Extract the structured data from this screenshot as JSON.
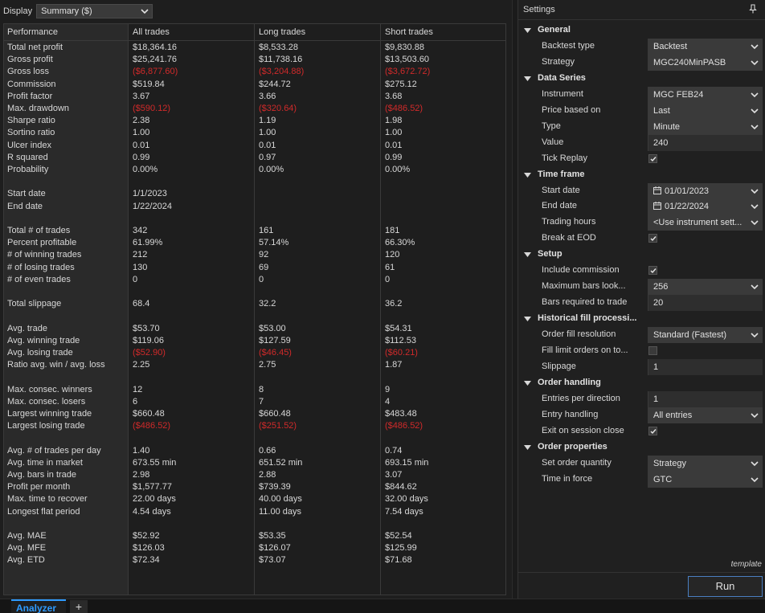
{
  "display": {
    "label": "Display",
    "selected": "Summary ($)"
  },
  "table": {
    "headers": [
      "Performance",
      "All trades",
      "Long trades",
      "Short trades"
    ],
    "rows": [
      {
        "name": "Total net profit",
        "all": "$18,364.16",
        "long": "$8,533.28",
        "short": "$9,830.88",
        "neg": false
      },
      {
        "name": "Gross profit",
        "all": "$25,241.76",
        "long": "$11,738.16",
        "short": "$13,503.60",
        "neg": false
      },
      {
        "name": "Gross loss",
        "all": "($6,877.60)",
        "long": "($3,204.88)",
        "short": "($3,672.72)",
        "neg": true
      },
      {
        "name": "Commission",
        "all": "$519.84",
        "long": "$244.72",
        "short": "$275.12",
        "neg": false
      },
      {
        "name": "Profit factor",
        "all": "3.67",
        "long": "3.66",
        "short": "3.68",
        "neg": false
      },
      {
        "name": "Max. drawdown",
        "all": "($590.12)",
        "long": "($320.64)",
        "short": "($486.52)",
        "neg": true
      },
      {
        "name": "Sharpe ratio",
        "all": "2.38",
        "long": "1.19",
        "short": "1.98",
        "neg": false
      },
      {
        "name": "Sortino ratio",
        "all": "1.00",
        "long": "1.00",
        "short": "1.00",
        "neg": false
      },
      {
        "name": "Ulcer index",
        "all": "0.01",
        "long": "0.01",
        "short": "0.01",
        "neg": false
      },
      {
        "name": "R squared",
        "all": "0.99",
        "long": "0.97",
        "short": "0.99",
        "neg": false
      },
      {
        "name": "Probability",
        "all": "0.00%",
        "long": "0.00%",
        "short": "0.00%",
        "neg": false
      },
      {
        "name": "",
        "all": "",
        "long": "",
        "short": "",
        "neg": false
      },
      {
        "name": "Start date",
        "all": "1/1/2023",
        "long": "",
        "short": "",
        "neg": false
      },
      {
        "name": "End date",
        "all": "1/22/2024",
        "long": "",
        "short": "",
        "neg": false
      },
      {
        "name": "",
        "all": "",
        "long": "",
        "short": "",
        "neg": false
      },
      {
        "name": "Total # of trades",
        "all": "342",
        "long": "161",
        "short": "181",
        "neg": false
      },
      {
        "name": "Percent profitable",
        "all": "61.99%",
        "long": "57.14%",
        "short": "66.30%",
        "neg": false
      },
      {
        "name": "# of winning trades",
        "all": "212",
        "long": "92",
        "short": "120",
        "neg": false
      },
      {
        "name": "# of losing trades",
        "all": "130",
        "long": "69",
        "short": "61",
        "neg": false
      },
      {
        "name": "# of even trades",
        "all": "0",
        "long": "0",
        "short": "0",
        "neg": false
      },
      {
        "name": "",
        "all": "",
        "long": "",
        "short": "",
        "neg": false
      },
      {
        "name": "Total slippage",
        "all": "68.4",
        "long": "32.2",
        "short": "36.2",
        "neg": false
      },
      {
        "name": "",
        "all": "",
        "long": "",
        "short": "",
        "neg": false
      },
      {
        "name": "Avg. trade",
        "all": "$53.70",
        "long": "$53.00",
        "short": "$54.31",
        "neg": false
      },
      {
        "name": "Avg. winning trade",
        "all": "$119.06",
        "long": "$127.59",
        "short": "$112.53",
        "neg": false
      },
      {
        "name": "Avg. losing trade",
        "all": "($52.90)",
        "long": "($46.45)",
        "short": "($60.21)",
        "neg": true
      },
      {
        "name": "Ratio avg. win / avg. loss",
        "all": "2.25",
        "long": "2.75",
        "short": "1.87",
        "neg": false
      },
      {
        "name": "",
        "all": "",
        "long": "",
        "short": "",
        "neg": false
      },
      {
        "name": "Max. consec. winners",
        "all": "12",
        "long": "8",
        "short": "9",
        "neg": false
      },
      {
        "name": "Max. consec. losers",
        "all": "6",
        "long": "7",
        "short": "4",
        "neg": false
      },
      {
        "name": "Largest winning trade",
        "all": "$660.48",
        "long": "$660.48",
        "short": "$483.48",
        "neg": false
      },
      {
        "name": "Largest losing trade",
        "all": "($486.52)",
        "long": "($251.52)",
        "short": "($486.52)",
        "neg": true
      },
      {
        "name": "",
        "all": "",
        "long": "",
        "short": "",
        "neg": false
      },
      {
        "name": "Avg. # of trades per day",
        "all": "1.40",
        "long": "0.66",
        "short": "0.74",
        "neg": false
      },
      {
        "name": "Avg. time in market",
        "all": "673.55 min",
        "long": "651.52 min",
        "short": "693.15 min",
        "neg": false
      },
      {
        "name": "Avg. bars in trade",
        "all": "2.98",
        "long": "2.88",
        "short": "3.07",
        "neg": false
      },
      {
        "name": "Profit per month",
        "all": "$1,577.77",
        "long": "$739.39",
        "short": "$844.62",
        "neg": false
      },
      {
        "name": "Max. time to recover",
        "all": "22.00 days",
        "long": "40.00 days",
        "short": "32.00 days",
        "neg": false
      },
      {
        "name": "Longest flat period",
        "all": "4.54 days",
        "long": "11.00 days",
        "short": "7.54 days",
        "neg": false
      },
      {
        "name": "",
        "all": "",
        "long": "",
        "short": "",
        "neg": false
      },
      {
        "name": "Avg. MAE",
        "all": "$52.92",
        "long": "$53.35",
        "short": "$52.54",
        "neg": false
      },
      {
        "name": "Avg. MFE",
        "all": "$126.03",
        "long": "$126.07",
        "short": "$125.99",
        "neg": false
      },
      {
        "name": "Avg. ETD",
        "all": "$72.34",
        "long": "$73.07",
        "short": "$71.68",
        "neg": false
      }
    ]
  },
  "settings": {
    "title": "Settings",
    "template_label": "template",
    "run_label": "Run",
    "rows": [
      {
        "kind": "cat",
        "label": "General"
      },
      {
        "kind": "drop",
        "label": "Backtest type",
        "value": "Backtest"
      },
      {
        "kind": "drop",
        "label": "Strategy",
        "value": "MGC240MinPASB"
      },
      {
        "kind": "cat",
        "label": "Data Series"
      },
      {
        "kind": "drop",
        "label": "Instrument",
        "value": "MGC FEB24"
      },
      {
        "kind": "drop",
        "label": "Price based on",
        "value": "Last"
      },
      {
        "kind": "drop",
        "label": "Type",
        "value": "Minute"
      },
      {
        "kind": "text",
        "label": "Value",
        "value": "240"
      },
      {
        "kind": "check",
        "label": "Tick Replay",
        "checked": true
      },
      {
        "kind": "cat",
        "label": "Time frame"
      },
      {
        "kind": "date",
        "label": "Start date",
        "value": "01/01/2023"
      },
      {
        "kind": "date",
        "label": "End date",
        "value": "01/22/2024"
      },
      {
        "kind": "drop",
        "label": "Trading hours",
        "value": "<Use instrument sett..."
      },
      {
        "kind": "check",
        "label": "Break at EOD",
        "checked": true
      },
      {
        "kind": "cat",
        "label": "Setup"
      },
      {
        "kind": "check",
        "label": "Include commission",
        "checked": true
      },
      {
        "kind": "drop",
        "label": "Maximum bars look...",
        "value": "256"
      },
      {
        "kind": "text",
        "label": "Bars required to trade",
        "value": "20"
      },
      {
        "kind": "cat",
        "label": "Historical fill processi..."
      },
      {
        "kind": "drop",
        "label": "Order fill resolution",
        "value": "Standard (Fastest)"
      },
      {
        "kind": "check",
        "label": "Fill limit orders on to...",
        "checked": false
      },
      {
        "kind": "text",
        "label": "Slippage",
        "value": "1"
      },
      {
        "kind": "cat",
        "label": "Order handling"
      },
      {
        "kind": "text",
        "label": "Entries per direction",
        "value": "1"
      },
      {
        "kind": "drop",
        "label": "Entry handling",
        "value": "All entries"
      },
      {
        "kind": "check",
        "label": "Exit on session close",
        "checked": true
      },
      {
        "kind": "cat",
        "label": "Order properties"
      },
      {
        "kind": "drop",
        "label": "Set order quantity",
        "value": "Strategy"
      },
      {
        "kind": "drop",
        "label": "Time in force",
        "value": "GTC"
      }
    ]
  },
  "tabs": {
    "active": "Analyzer",
    "add": "+"
  },
  "colors": {
    "negative": "#d02a2a",
    "accent": "#2e9bff"
  }
}
